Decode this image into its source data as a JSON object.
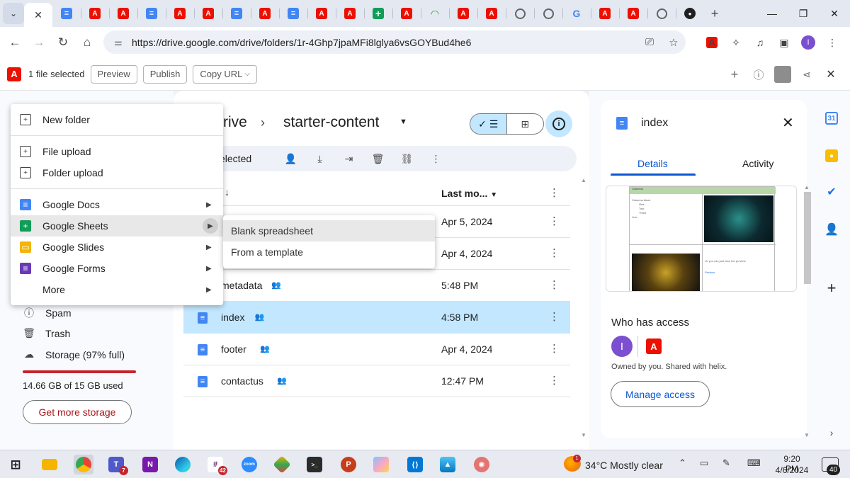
{
  "browser": {
    "tabs": [
      {
        "kind": "dropdown"
      },
      {
        "kind": "active-close",
        "icon": "close-icon"
      },
      {
        "kind": "docs"
      },
      {
        "kind": "adobe"
      },
      {
        "kind": "adobe"
      },
      {
        "kind": "docs"
      },
      {
        "kind": "adobe"
      },
      {
        "kind": "adobe"
      },
      {
        "kind": "docs"
      },
      {
        "kind": "adobe"
      },
      {
        "kind": "docs"
      },
      {
        "kind": "adobe"
      },
      {
        "kind": "adobe"
      },
      {
        "kind": "sheets"
      },
      {
        "kind": "adobe"
      },
      {
        "kind": "wifi"
      },
      {
        "kind": "adobe"
      },
      {
        "kind": "adobe"
      },
      {
        "kind": "globe"
      },
      {
        "kind": "globe"
      },
      {
        "kind": "google"
      },
      {
        "kind": "adobe"
      },
      {
        "kind": "adobe"
      },
      {
        "kind": "globe"
      },
      {
        "kind": "github"
      }
    ],
    "url": "https://drive.google.com/drive/folders/1r-4Ghp7jpaMFi8lglya6vsGOYBud4he6",
    "profile_initial": "I"
  },
  "sidekick": {
    "status": "1 file selected",
    "buttons": [
      "Preview",
      "Publish",
      "Copy URL"
    ]
  },
  "sidebar": {
    "items": [
      {
        "label": "Spam",
        "icon": "spam-icon"
      },
      {
        "label": "Trash",
        "icon": "trash-icon"
      },
      {
        "label": "Storage (97% full)",
        "icon": "cloud-icon"
      }
    ],
    "storage_used_fraction": 0.97,
    "storage_text": "14.66 GB of 15 GB used",
    "get_storage": "Get more storage"
  },
  "drive": {
    "breadcrumb_root": "rive",
    "breadcrumb_current": "starter-content",
    "selection_text": "elected",
    "sort_header": "Last mo...",
    "rows": [
      {
        "name": "",
        "date": "Apr 5, 2024",
        "shared": false,
        "selected": false
      },
      {
        "name": "",
        "date": "Apr 4, 2024",
        "shared": false,
        "selected": false
      },
      {
        "name": "metadata",
        "date": "5:48 PM",
        "shared": true,
        "selected": false
      },
      {
        "name": "index",
        "date": "4:58 PM",
        "shared": true,
        "selected": true
      },
      {
        "name": "footer",
        "date": "Apr 4, 2024",
        "shared": true,
        "selected": false
      },
      {
        "name": "contactus",
        "date": "12:47 PM",
        "shared": true,
        "selected": false
      }
    ]
  },
  "new_menu": {
    "items": [
      {
        "label": "New folder",
        "icon": "new-folder-icon",
        "style": "outline",
        "arrow": false
      },
      {
        "divider": true
      },
      {
        "label": "File upload",
        "icon": "file-upload-icon",
        "style": "outline",
        "arrow": false
      },
      {
        "label": "Folder upload",
        "icon": "folder-upload-icon",
        "style": "outline",
        "arrow": false
      },
      {
        "divider": true
      },
      {
        "label": "Google Docs",
        "icon": "google-docs-icon",
        "style": "docs",
        "arrow": true
      },
      {
        "label": "Google Sheets",
        "icon": "google-sheets-icon",
        "style": "sheets",
        "arrow": true,
        "hover": true
      },
      {
        "label": "Google Slides",
        "icon": "google-slides-icon",
        "style": "slides",
        "arrow": true
      },
      {
        "label": "Google Forms",
        "icon": "google-forms-icon",
        "style": "forms",
        "arrow": true
      },
      {
        "label": "More",
        "icon": "",
        "style": "blank",
        "arrow": true
      }
    ],
    "submenu": [
      "Blank spreadsheet",
      "From a template"
    ]
  },
  "details": {
    "title": "index",
    "tabs": [
      "Details",
      "Activity"
    ],
    "preview": {
      "header": "Columns",
      "block_title": "Columns block",
      "list": [
        "One",
        "Two",
        "Three"
      ],
      "link": "Live",
      "text2": "Or you can just view the preview",
      "link2": "Preview"
    },
    "access_heading": "Who has access",
    "owner_initial": "I",
    "owned_text": "Owned by you. Shared with helix.",
    "manage_button": "Manage access"
  },
  "taskbar": {
    "weather": "34°C  Mostly clear",
    "weather_badge": "1",
    "time": "9:20 PM",
    "date": "4/6/2024",
    "notifications": "40",
    "teams_badge": "7",
    "slack_badge": "42"
  },
  "colors": {
    "accent_blue": "#0b57d0",
    "selected_row": "#c2e7ff",
    "adobe_red": "#eb1000",
    "storage_red": "#c4262d"
  }
}
